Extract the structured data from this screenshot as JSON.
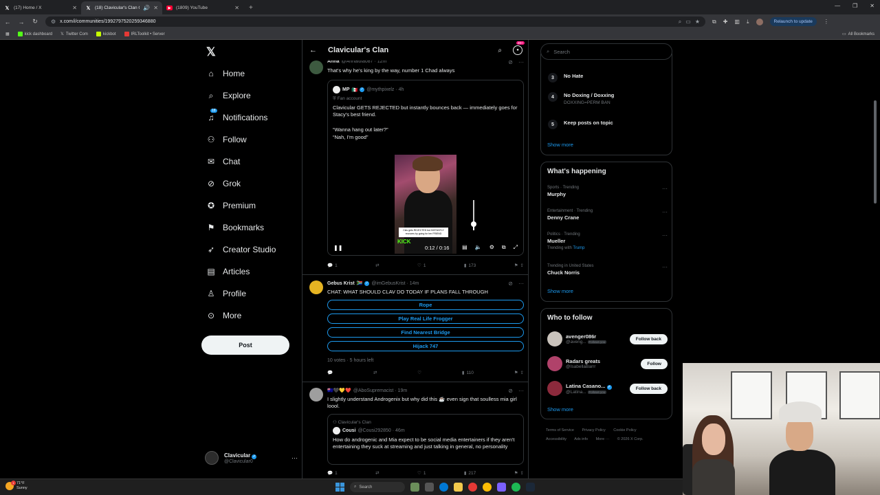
{
  "browser": {
    "tabs": [
      {
        "title": "(17) Home / X",
        "icon": "x-logo-icon",
        "active": false
      },
      {
        "title": "(18) Clavicular's Clan Comm",
        "icon": "x-logo-icon",
        "active": true
      },
      {
        "title": "(1809) YouTube",
        "icon": "youtube-icon",
        "active": false
      }
    ],
    "url": "x.com/i/communities/1992797520259346880",
    "relaunch_label": "Relaunch to update",
    "bookmarks": [
      "kick dashboard",
      "Twitter Com",
      "kickbot",
      "IRLToolkit • Server"
    ],
    "all_bookmarks_label": "All Bookmarks"
  },
  "nav": {
    "items": [
      {
        "label": "Home",
        "icon": "home-icon"
      },
      {
        "label": "Explore",
        "icon": "search-icon"
      },
      {
        "label": "Notifications",
        "icon": "bell-icon",
        "badge": "18"
      },
      {
        "label": "Follow",
        "icon": "follow-icon"
      },
      {
        "label": "Chat",
        "icon": "mail-icon"
      },
      {
        "label": "Grok",
        "icon": "grok-icon"
      },
      {
        "label": "Premium",
        "icon": "premium-icon"
      },
      {
        "label": "Bookmarks",
        "icon": "bookmark-icon"
      },
      {
        "label": "Creator Studio",
        "icon": "rocket-icon"
      },
      {
        "label": "Articles",
        "icon": "articles-icon"
      },
      {
        "label": "Profile",
        "icon": "person-icon"
      },
      {
        "label": "More",
        "icon": "more-circle-icon"
      }
    ],
    "post_label": "Post",
    "account": {
      "name": "Clavicular",
      "handle": "@Clavicular0"
    }
  },
  "header": {
    "title": "Clavicular's Clan",
    "notif_badge": "20+"
  },
  "posts": [
    {
      "name": "Anna",
      "handle": "@Annalola087 · 12m",
      "text": "That's why he's king by the way, number 1 Chad always",
      "quote": {
        "name": "MP",
        "handle": "@mythpixelz · 4h",
        "fan_label": "Fan account",
        "text1": "Clavicular GETS REJECTED but instantly bounces back — immediately goes for Stacy's best friend.",
        "text2": "“Wanna hang out later?”",
        "text3": "“Nah, I'm good”"
      },
      "video": {
        "time": "0:12 / 0:16",
        "caption": "Clav gets REJECTED but INSTANTLY recovers by going for her FRIEND",
        "overlay_brand": "KICK",
        "volume": 0.2
      },
      "actions": {
        "replies": "1",
        "reposts": "",
        "likes": "1",
        "views": "173"
      }
    },
    {
      "name": "Gebus Krist",
      "handle": "@imGebusKrist · 14m",
      "text": "CHAT: WHAT SHOULD CLAV DO TODAY IF PLANS FALL THROUGH",
      "poll": [
        "Rope",
        "Play Real Life Frogger",
        "Find Nearest Bridge",
        "Hijack 747"
      ],
      "poll_meta": "10 votes · 5 hours left",
      "actions": {
        "replies": "",
        "reposts": "",
        "likes": "",
        "views": "110"
      }
    },
    {
      "name": "",
      "handle": "@AboSupremacist · 19m",
      "text": "I slightly understand Androgenix but why did this ☕ even sign that soulless mia girl loool.",
      "quote": {
        "community": "Clavicular's Clan",
        "name": "Cousi",
        "handle": "@Cousi292850 · 46m",
        "text": "How do androgenic and Mia expect to be social media entertainers if they aren't entertaining they suck at streaming and just talking in general, no personality"
      },
      "actions": {
        "replies": "1",
        "reposts": "",
        "likes": "1",
        "views": "217"
      }
    }
  ],
  "right": {
    "search_placeholder": "Search",
    "rules": [
      {
        "num": "3",
        "title": "No Hate",
        "sub": ""
      },
      {
        "num": "4",
        "title": "No Doxing / Doxxing",
        "sub": "DOXXING=PERM BAN"
      },
      {
        "num": "5",
        "title": "Keep posts on topic",
        "sub": ""
      }
    ],
    "show_more": "Show more",
    "happening_title": "What's happening",
    "trends": [
      {
        "context": "Sports · Trending",
        "name": "Murphy",
        "with": ""
      },
      {
        "context": "Entertainment · Trending",
        "name": "Denny Crane",
        "with": ""
      },
      {
        "context": "Politics · Trending",
        "name": "Mueller",
        "with_prefix": "Trending with",
        "with": "Trump"
      },
      {
        "context": "Trending in United States",
        "name": "Chuck Norris",
        "with": ""
      }
    ],
    "wtf_title": "Who to follow",
    "wtf": [
      {
        "name": "avenger086r",
        "handle": "@aveng...",
        "follows_you": "Follows you",
        "button": "Follow back"
      },
      {
        "name": "Radars greats",
        "handle": "@IsabellaBarrr",
        "follows_you": "",
        "button": "Follow"
      },
      {
        "name": "Latina Casano...",
        "handle": "@Latina...",
        "follows_you": "Follows you",
        "button": "Follow back"
      }
    ],
    "footer": [
      "Terms of Service",
      "Privacy Policy",
      "Cookie Policy",
      "Accessibility",
      "Ads info",
      "More ···",
      "© 2026 X Corp."
    ]
  },
  "taskbar": {
    "temp": "71°F",
    "condition": "Sunny",
    "search_placeholder": "Search"
  }
}
